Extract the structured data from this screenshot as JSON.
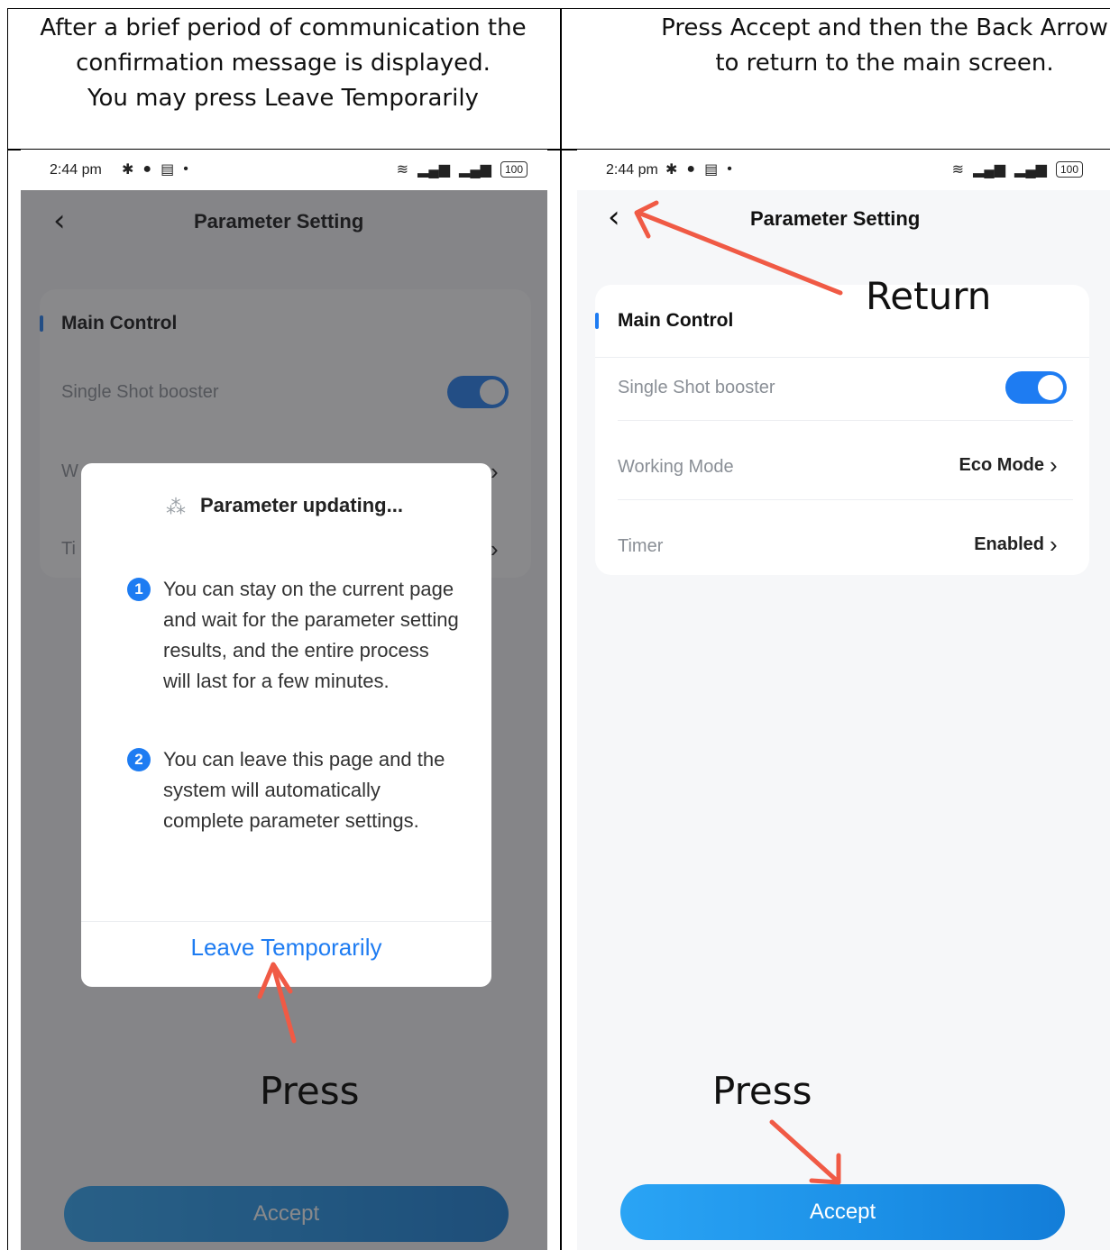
{
  "instructions": {
    "left": [
      "After a brief period of communication the",
      "confirmation message is displayed.",
      "You may press Leave Temporarily"
    ],
    "right": [
      "Press Accept and then the Back Arrow",
      "to return to the main screen."
    ]
  },
  "status_bar": {
    "time": "2:44 pm",
    "battery": "100"
  },
  "screen": {
    "title": "Parameter Setting",
    "section_title": "Main Control",
    "rows": [
      {
        "label": "Single Shot booster",
        "value": ""
      },
      {
        "label": "Working Mode",
        "value": "Eco Mode"
      },
      {
        "label": "Timer",
        "value": "Enabled"
      }
    ],
    "toggle_on": true,
    "accept_label": "Accept"
  },
  "left_obscured": {
    "row2": "W",
    "row3": "Ti"
  },
  "dialog": {
    "title": "Parameter updating...",
    "items": [
      {
        "num": "1",
        "text": "You can stay on the current page and wait for the parameter setting results, and the entire process will last for a few minutes."
      },
      {
        "num": "2",
        "text": "You can leave this page and the system will automatically complete parameter settings."
      }
    ],
    "leave_label": "Leave Temporarily"
  },
  "annotations": {
    "press_left": "Press",
    "press_right": "Press",
    "return": "Return"
  },
  "colors": {
    "accent": "#1e7cf2",
    "arrow": "#f05a45"
  }
}
